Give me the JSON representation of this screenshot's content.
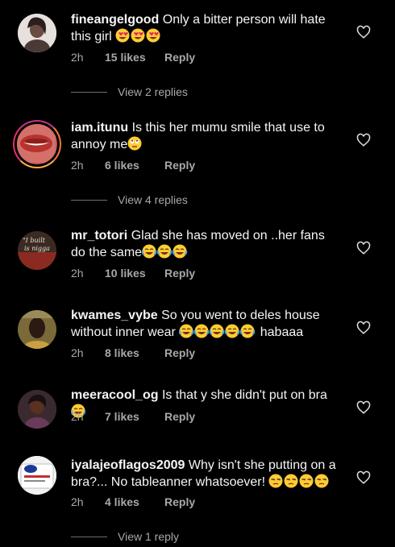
{
  "comments": [
    {
      "username": "fineangelgood",
      "text": "Only a bitter person will hate this girl",
      "emoji": [
        "heart-eyes",
        "heart-eyes",
        "heart-eyes"
      ],
      "time": "2h",
      "likes": "15 likes",
      "reply": "Reply",
      "view_replies": "View 2 replies"
    },
    {
      "username": "iam.itunu",
      "text": "Is this her mumu smile that use to annoy me",
      "emoji": [
        "eye-roll"
      ],
      "time": "2h",
      "likes": "6 likes",
      "reply": "Reply",
      "view_replies": "View 4 replies"
    },
    {
      "username": "mr_totori",
      "text": "Glad she has moved on ..her fans do the same",
      "emoji": [
        "joy",
        "joy",
        "joy"
      ],
      "time": "2h",
      "likes": "10 likes",
      "reply": "Reply",
      "avatar_text": "I built ... is nigga"
    },
    {
      "username": "kwames_vybe",
      "text": "So you went to deles house without inner wear",
      "emoji": [
        "joy",
        "joy",
        "joy",
        "joy",
        "joy"
      ],
      "text_after": "habaaa",
      "time": "2h",
      "likes": "8 likes",
      "reply": "Reply"
    },
    {
      "username": "meeracool_og",
      "text": "Is that y she didn't put on bra",
      "emoji": [
        "joy"
      ],
      "time": "2h",
      "likes": "7 likes",
      "reply": "Reply"
    },
    {
      "username": "iyalajeoflagos2009",
      "text": "Why isn't she putting on a bra?... No tableanner whatsoever!",
      "emoji": [
        "unamused",
        "unamused",
        "unamused",
        "unamused"
      ],
      "time": "2h",
      "likes": "4 likes",
      "reply": "Reply",
      "view_replies": "View 1 reply"
    }
  ],
  "colors": {
    "background": "#000000",
    "text": "#f5f5f5",
    "secondary": "#a8a8a8",
    "story_ring": "#e1306c"
  }
}
